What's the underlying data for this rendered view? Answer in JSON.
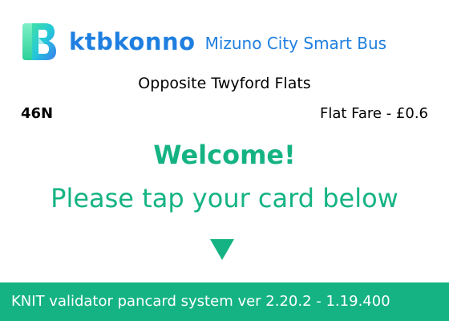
{
  "header": {
    "logo_icon": "ktbkonno-k-logo-icon",
    "brand": "ktbkonno",
    "city": "Mizuno City Smart Bus",
    "brand_color": "#1f7fe0"
  },
  "stop": {
    "name": "Opposite Twyford Flats"
  },
  "route": {
    "number": "46N",
    "fare": "Flat Fare - £0.6"
  },
  "main": {
    "welcome": "Welcome!",
    "instruction": "Please tap your card below",
    "arrow_icon": "arrow-down-icon",
    "accent_color": "#15b383"
  },
  "footer": {
    "version": "KNIT validator pancard system ver 2.20.2 - 1.19.400"
  }
}
